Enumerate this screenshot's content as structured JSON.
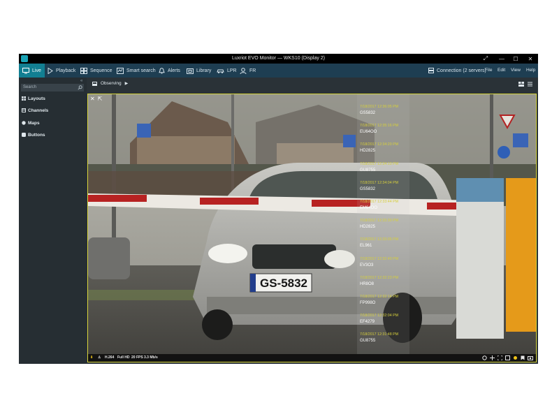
{
  "window": {
    "title": "Luxriot EVO Monitor — WKS10 (Display 2)"
  },
  "toolbar": {
    "items": [
      {
        "label": "Live",
        "icon": "monitor-icon"
      },
      {
        "label": "Playback",
        "icon": "play-icon"
      },
      {
        "label": "Sequence",
        "icon": "sequence-grid-icon"
      },
      {
        "label": "Smart search",
        "icon": "smart-search-icon"
      },
      {
        "label": "Alerts",
        "icon": "bell-icon"
      },
      {
        "label": "Library",
        "icon": "library-icon"
      },
      {
        "label": "LPR",
        "icon": "car-icon"
      },
      {
        "label": "FR",
        "icon": "face-icon"
      }
    ],
    "connection": "Connection (2 servers)",
    "menus": [
      "File",
      "Edit",
      "View",
      "Help"
    ]
  },
  "sidebar": {
    "search_placeholder": "Search",
    "items": [
      {
        "label": "Layouts",
        "icon": "layouts-icon"
      },
      {
        "label": "Channels",
        "icon": "channels-icon"
      },
      {
        "label": "Maps",
        "icon": "globe-icon"
      },
      {
        "label": "Buttons",
        "icon": "buttons-icon"
      }
    ]
  },
  "main": {
    "mode_label": "Observing"
  },
  "video": {
    "status": {
      "codec": "H.264",
      "resolution": "Full HD",
      "fps": "20 FPS",
      "bitrate": "3.3 Mb/s"
    },
    "plate_text": "GS-5832",
    "lpr_events": [
      {
        "time": "7/18/2017 12:36:05 PM",
        "plate": "GS5832"
      },
      {
        "time": "7/18/2017 12:35:16 PM",
        "plate": "EU64OO"
      },
      {
        "time": "7/18/2017 12:34:20 PM",
        "plate": "HD2825"
      },
      {
        "time": "7/18/2017 12:34:10 PM",
        "plate": "GU8755"
      },
      {
        "time": "7/18/2017 12:34:04 PM",
        "plate": "GS5832"
      },
      {
        "time": "7/18/2017 12:33:44 PM",
        "plate": "EM64OO"
      },
      {
        "time": "7/18/2017 12:33:30 PM",
        "plate": "HD2825"
      },
      {
        "time": "7/18/2017 12:33:05 PM",
        "plate": "EL961"
      },
      {
        "time": "7/18/2017 12:32:40 PM",
        "plate": "EV3O3"
      },
      {
        "time": "7/18/2017 12:32:23 PM",
        "plate": "HR8O8"
      },
      {
        "time": "7/18/2017 12:32:14 PM",
        "plate": "FP998O"
      },
      {
        "time": "7/18/2017 12:32:04 PM",
        "plate": "EF4279"
      },
      {
        "time": "7/18/2017 12:31:48 PM",
        "plate": "GU8755"
      }
    ]
  },
  "colors": {
    "accent": "#127f92",
    "toolbar": "#1e3e52",
    "sidebar": "#262e33",
    "timestamp": "#d6cf3c",
    "frame": "#d7d43a"
  }
}
